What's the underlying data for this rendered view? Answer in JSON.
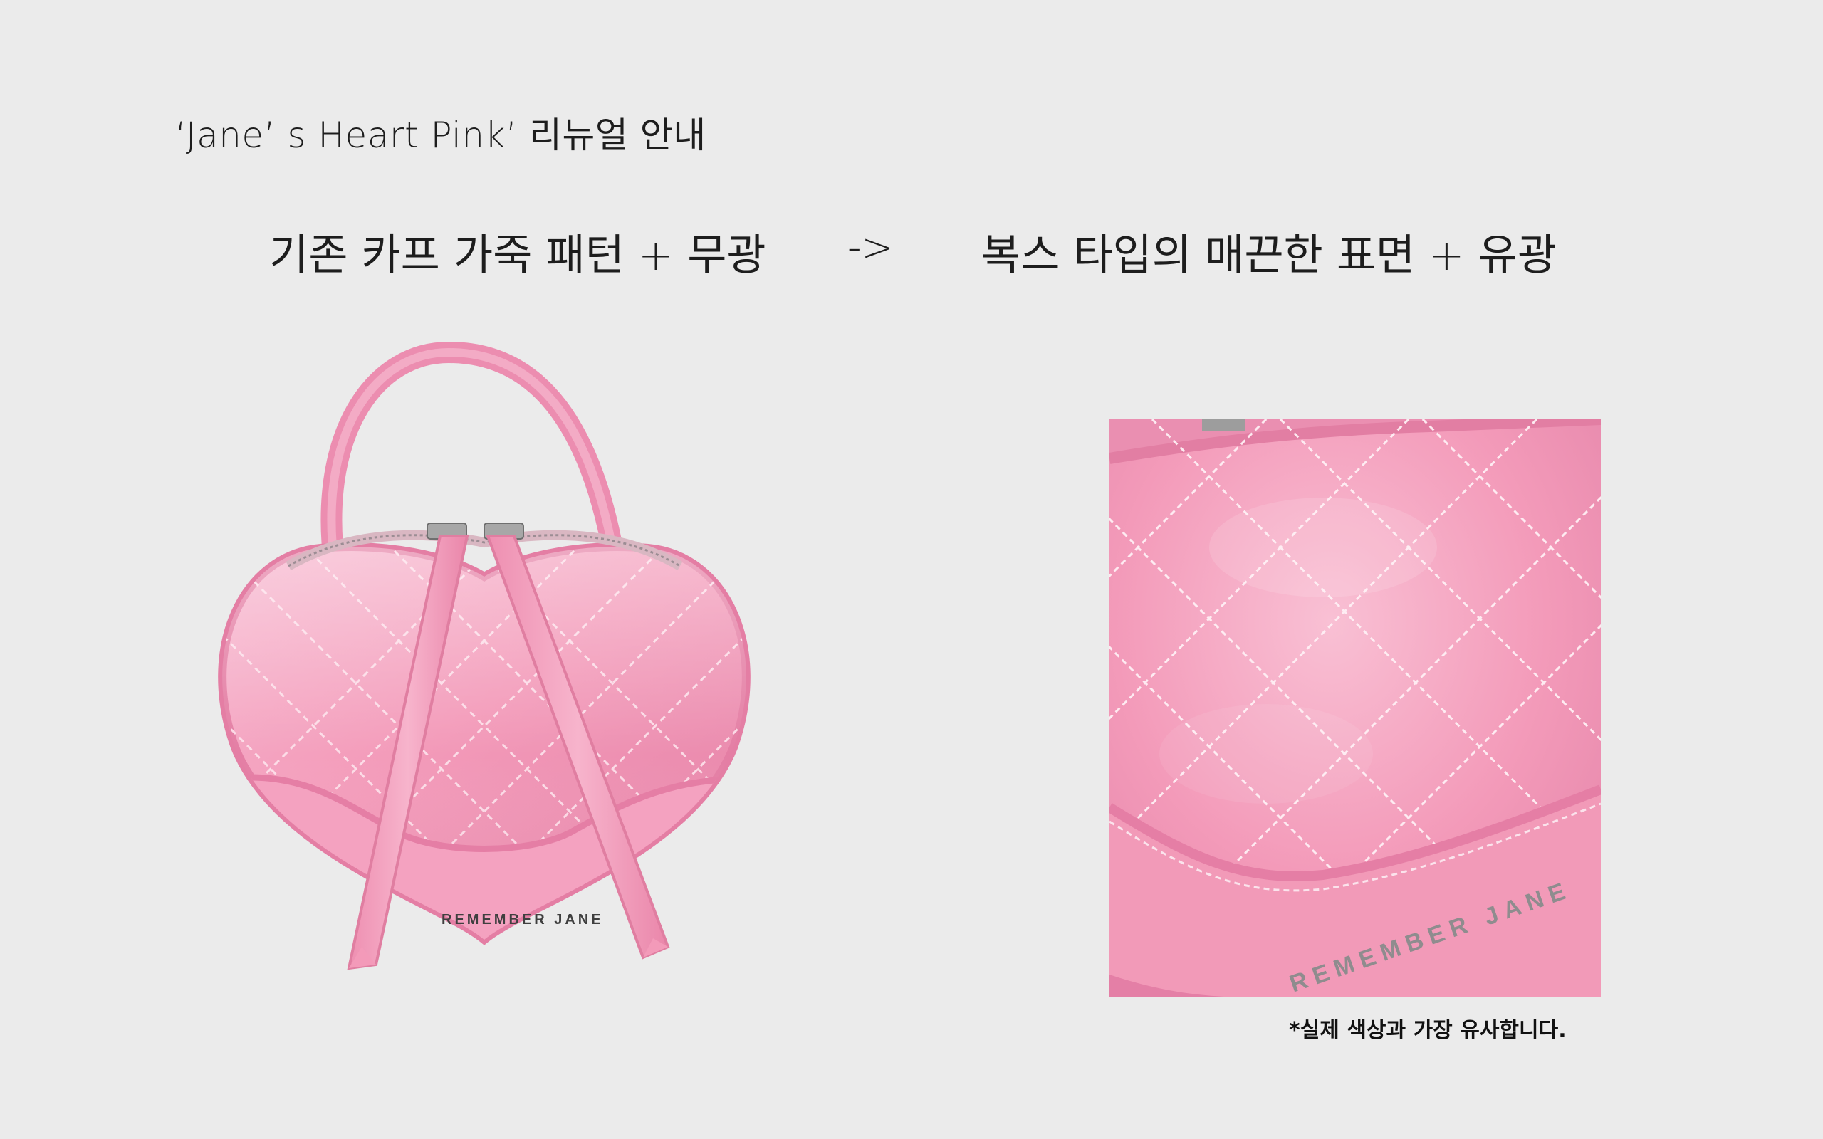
{
  "header": {
    "title": "‘Jane’ s Heart Pink’ 리뉴얼 안내"
  },
  "comparison": {
    "old": "기존 카프 가죽 패턴 + 무광",
    "arrow": "->",
    "new": "복스 타입의 매끈한 표면 + 유광"
  },
  "product": {
    "brand_text": "REMEMBER JANE",
    "detail_brand_text": "REMEMBER JANE",
    "color": "#f29bbb"
  },
  "footer": {
    "note": "*실제 색상과 가장 유사합니다."
  }
}
